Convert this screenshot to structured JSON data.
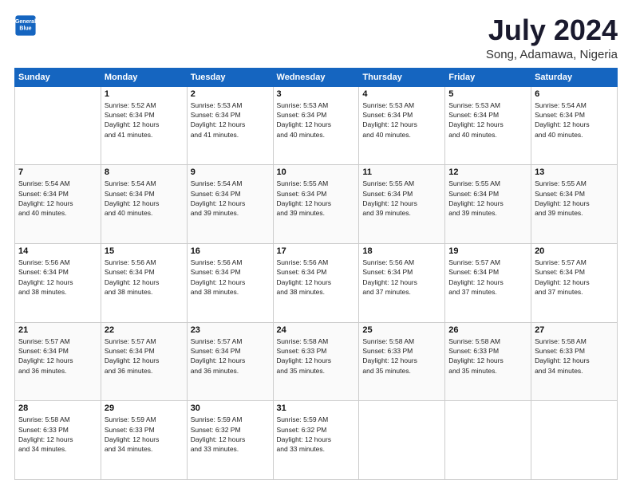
{
  "header": {
    "logo_line1": "General",
    "logo_line2": "Blue",
    "title": "July 2024",
    "subtitle": "Song, Adamawa, Nigeria"
  },
  "weekdays": [
    "Sunday",
    "Monday",
    "Tuesday",
    "Wednesday",
    "Thursday",
    "Friday",
    "Saturday"
  ],
  "weeks": [
    [
      {
        "day": "",
        "info": ""
      },
      {
        "day": "1",
        "info": "Sunrise: 5:52 AM\nSunset: 6:34 PM\nDaylight: 12 hours\nand 41 minutes."
      },
      {
        "day": "2",
        "info": "Sunrise: 5:53 AM\nSunset: 6:34 PM\nDaylight: 12 hours\nand 41 minutes."
      },
      {
        "day": "3",
        "info": "Sunrise: 5:53 AM\nSunset: 6:34 PM\nDaylight: 12 hours\nand 40 minutes."
      },
      {
        "day": "4",
        "info": "Sunrise: 5:53 AM\nSunset: 6:34 PM\nDaylight: 12 hours\nand 40 minutes."
      },
      {
        "day": "5",
        "info": "Sunrise: 5:53 AM\nSunset: 6:34 PM\nDaylight: 12 hours\nand 40 minutes."
      },
      {
        "day": "6",
        "info": "Sunrise: 5:54 AM\nSunset: 6:34 PM\nDaylight: 12 hours\nand 40 minutes."
      }
    ],
    [
      {
        "day": "7",
        "info": "Sunrise: 5:54 AM\nSunset: 6:34 PM\nDaylight: 12 hours\nand 40 minutes."
      },
      {
        "day": "8",
        "info": "Sunrise: 5:54 AM\nSunset: 6:34 PM\nDaylight: 12 hours\nand 40 minutes."
      },
      {
        "day": "9",
        "info": "Sunrise: 5:54 AM\nSunset: 6:34 PM\nDaylight: 12 hours\nand 39 minutes."
      },
      {
        "day": "10",
        "info": "Sunrise: 5:55 AM\nSunset: 6:34 PM\nDaylight: 12 hours\nand 39 minutes."
      },
      {
        "day": "11",
        "info": "Sunrise: 5:55 AM\nSunset: 6:34 PM\nDaylight: 12 hours\nand 39 minutes."
      },
      {
        "day": "12",
        "info": "Sunrise: 5:55 AM\nSunset: 6:34 PM\nDaylight: 12 hours\nand 39 minutes."
      },
      {
        "day": "13",
        "info": "Sunrise: 5:55 AM\nSunset: 6:34 PM\nDaylight: 12 hours\nand 39 minutes."
      }
    ],
    [
      {
        "day": "14",
        "info": "Sunrise: 5:56 AM\nSunset: 6:34 PM\nDaylight: 12 hours\nand 38 minutes."
      },
      {
        "day": "15",
        "info": "Sunrise: 5:56 AM\nSunset: 6:34 PM\nDaylight: 12 hours\nand 38 minutes."
      },
      {
        "day": "16",
        "info": "Sunrise: 5:56 AM\nSunset: 6:34 PM\nDaylight: 12 hours\nand 38 minutes."
      },
      {
        "day": "17",
        "info": "Sunrise: 5:56 AM\nSunset: 6:34 PM\nDaylight: 12 hours\nand 38 minutes."
      },
      {
        "day": "18",
        "info": "Sunrise: 5:56 AM\nSunset: 6:34 PM\nDaylight: 12 hours\nand 37 minutes."
      },
      {
        "day": "19",
        "info": "Sunrise: 5:57 AM\nSunset: 6:34 PM\nDaylight: 12 hours\nand 37 minutes."
      },
      {
        "day": "20",
        "info": "Sunrise: 5:57 AM\nSunset: 6:34 PM\nDaylight: 12 hours\nand 37 minutes."
      }
    ],
    [
      {
        "day": "21",
        "info": "Sunrise: 5:57 AM\nSunset: 6:34 PM\nDaylight: 12 hours\nand 36 minutes."
      },
      {
        "day": "22",
        "info": "Sunrise: 5:57 AM\nSunset: 6:34 PM\nDaylight: 12 hours\nand 36 minutes."
      },
      {
        "day": "23",
        "info": "Sunrise: 5:57 AM\nSunset: 6:34 PM\nDaylight: 12 hours\nand 36 minutes."
      },
      {
        "day": "24",
        "info": "Sunrise: 5:58 AM\nSunset: 6:33 PM\nDaylight: 12 hours\nand 35 minutes."
      },
      {
        "day": "25",
        "info": "Sunrise: 5:58 AM\nSunset: 6:33 PM\nDaylight: 12 hours\nand 35 minutes."
      },
      {
        "day": "26",
        "info": "Sunrise: 5:58 AM\nSunset: 6:33 PM\nDaylight: 12 hours\nand 35 minutes."
      },
      {
        "day": "27",
        "info": "Sunrise: 5:58 AM\nSunset: 6:33 PM\nDaylight: 12 hours\nand 34 minutes."
      }
    ],
    [
      {
        "day": "28",
        "info": "Sunrise: 5:58 AM\nSunset: 6:33 PM\nDaylight: 12 hours\nand 34 minutes."
      },
      {
        "day": "29",
        "info": "Sunrise: 5:59 AM\nSunset: 6:33 PM\nDaylight: 12 hours\nand 34 minutes."
      },
      {
        "day": "30",
        "info": "Sunrise: 5:59 AM\nSunset: 6:32 PM\nDaylight: 12 hours\nand 33 minutes."
      },
      {
        "day": "31",
        "info": "Sunrise: 5:59 AM\nSunset: 6:32 PM\nDaylight: 12 hours\nand 33 minutes."
      },
      {
        "day": "",
        "info": ""
      },
      {
        "day": "",
        "info": ""
      },
      {
        "day": "",
        "info": ""
      }
    ]
  ]
}
